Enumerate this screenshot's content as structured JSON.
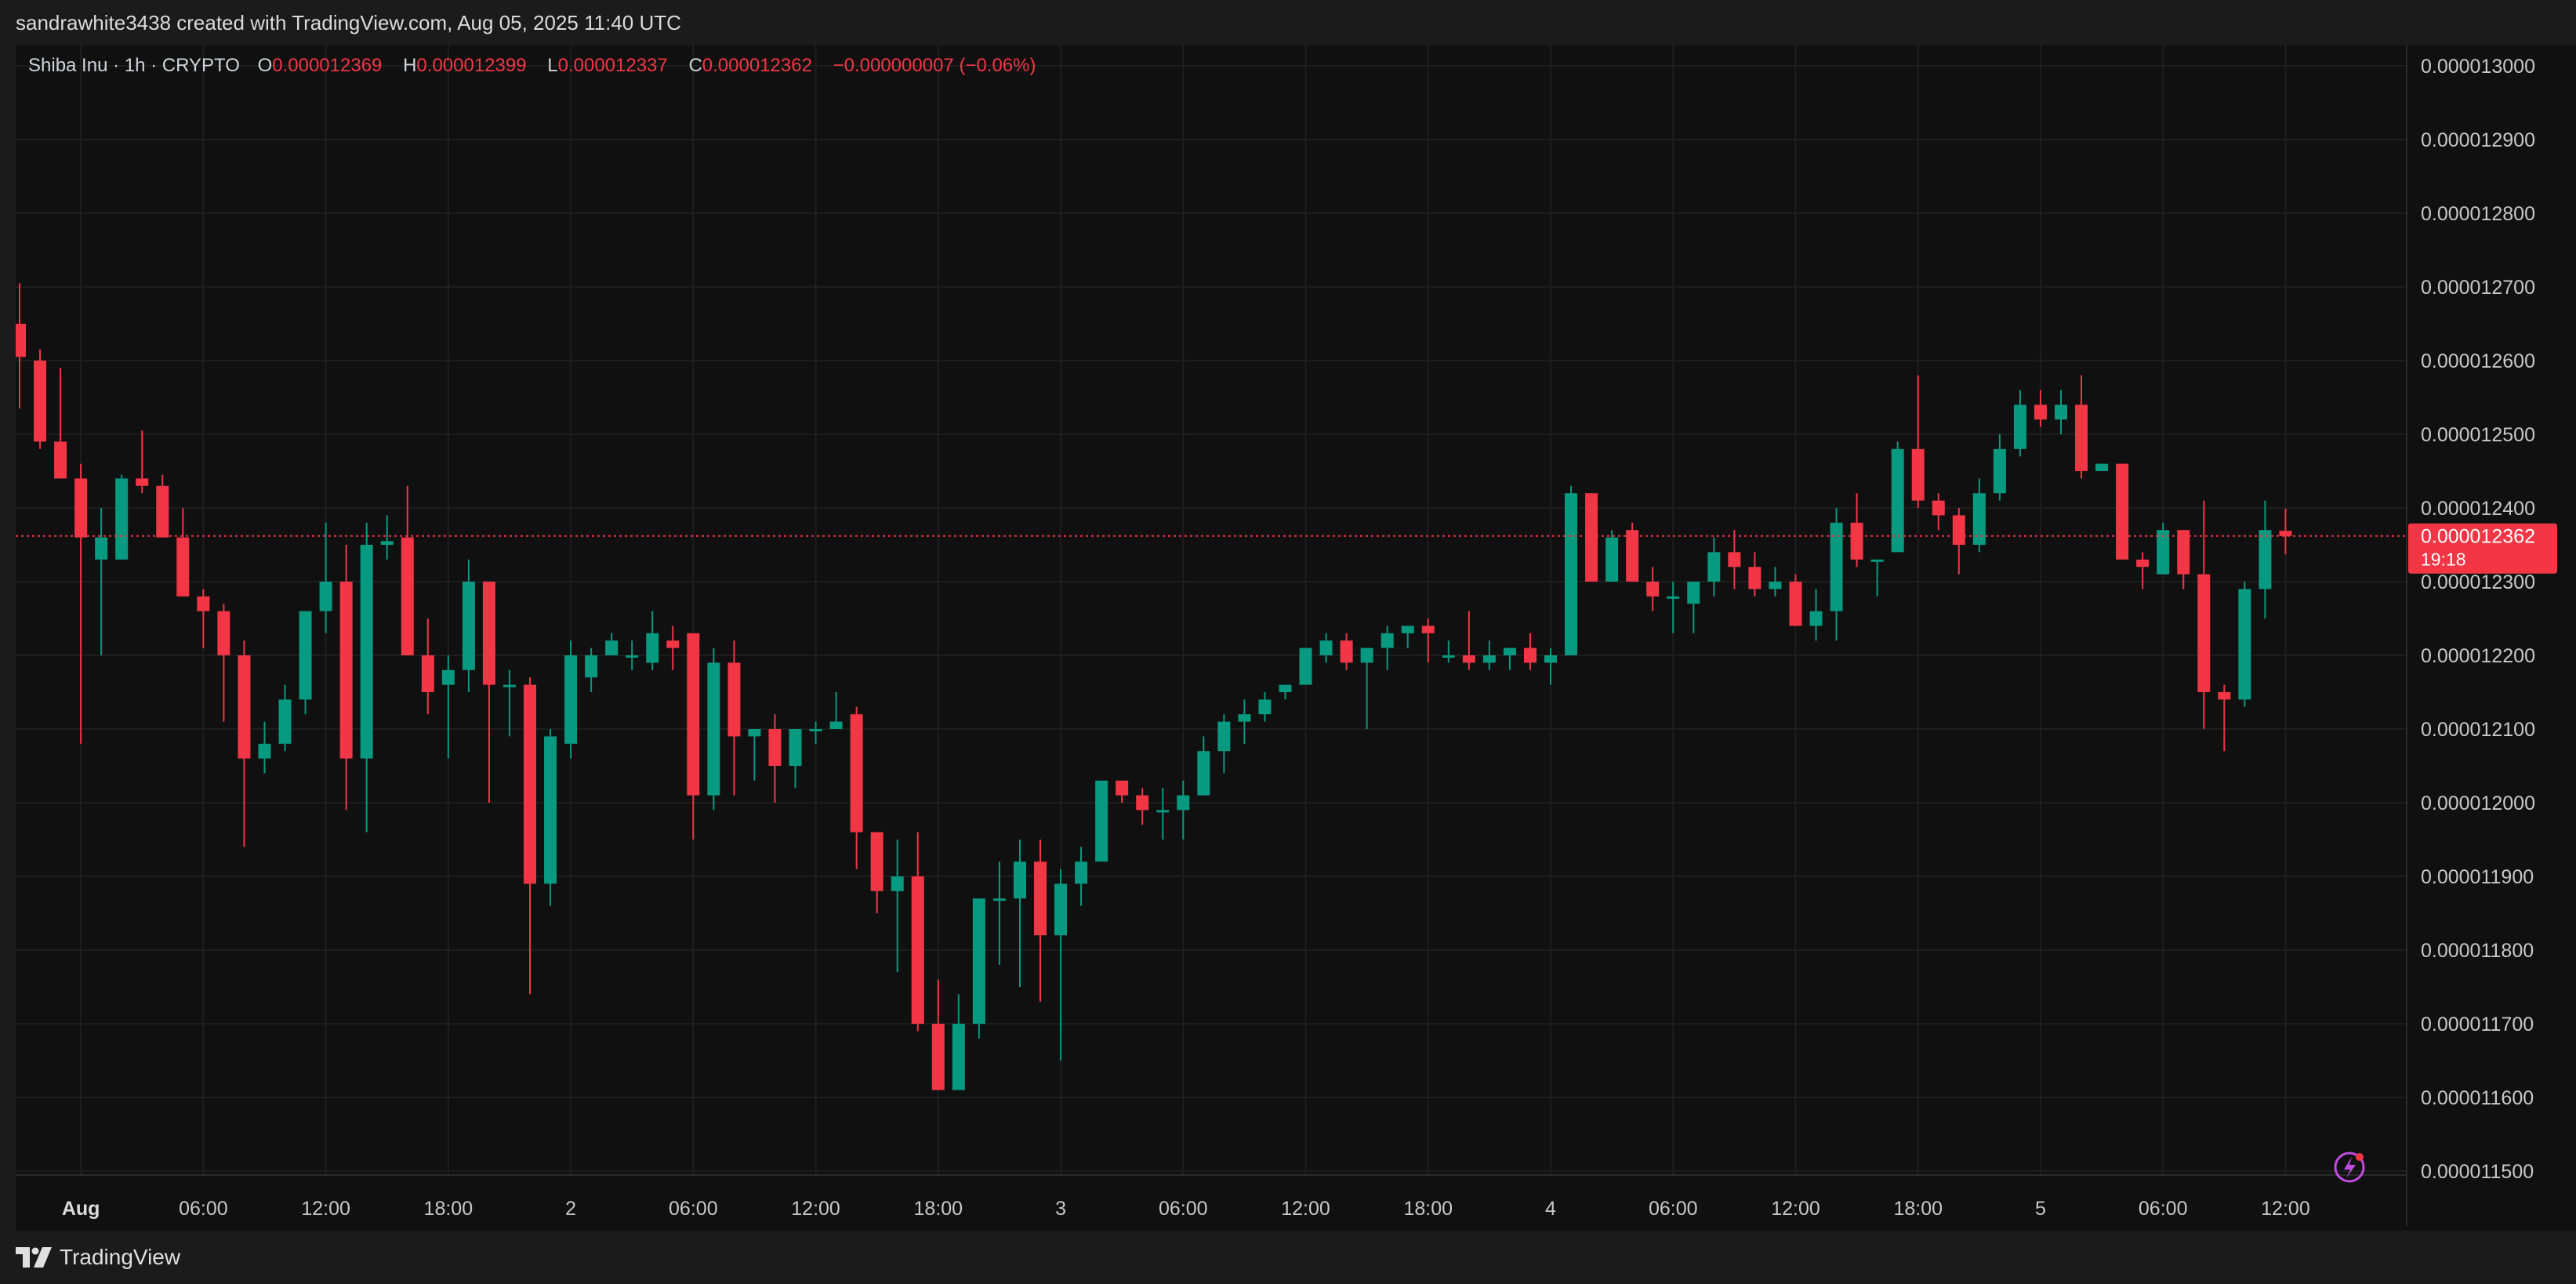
{
  "header": {
    "attribution": "sandrawhite3438 created with TradingView.com, Aug 05, 2025 11:40 UTC"
  },
  "legend": {
    "symbol": "Shiba Inu · 1h · CRYPTO",
    "open_label": "O",
    "open": "0.000012369",
    "high_label": "H",
    "high": "0.000012399",
    "low_label": "L",
    "low": "0.000012337",
    "close_label": "C",
    "close": "0.000012362",
    "change": "−0.000000007 (−0.06%)"
  },
  "price_tag": {
    "price": "0.000012362",
    "countdown": "19:18"
  },
  "footer": {
    "brand": "TradingView"
  },
  "colors": {
    "up": "#089981",
    "down": "#f23645",
    "background": "#101010",
    "frame": "#1b1b1b",
    "grid": "#1e1e1e"
  },
  "icons": {
    "brand": "tradingview-logo-icon",
    "lightning": "lightning-icon"
  },
  "chart_data": {
    "type": "candlestick",
    "interval": "1h",
    "y_axis": {
      "min": 1.15e-05,
      "max": 1.3e-05,
      "ticks": [
        "0.000013000",
        "0.000012900",
        "0.000012800",
        "0.000012700",
        "0.000012600",
        "0.000012500",
        "0.000012400",
        "0.000012300",
        "0.000012200",
        "0.000012100",
        "0.000012000",
        "0.000011900",
        "0.000011800",
        "0.000011700",
        "0.000011600",
        "0.000011500"
      ],
      "position": "right"
    },
    "x_axis": {
      "ticks": [
        {
          "label": "Aug",
          "index": 3,
          "bold": true
        },
        {
          "label": "06:00",
          "index": 9
        },
        {
          "label": "12:00",
          "index": 15
        },
        {
          "label": "18:00",
          "index": 21
        },
        {
          "label": "2",
          "index": 27
        },
        {
          "label": "06:00",
          "index": 33
        },
        {
          "label": "12:00",
          "index": 39
        },
        {
          "label": "18:00",
          "index": 45
        },
        {
          "label": "3",
          "index": 51
        },
        {
          "label": "06:00",
          "index": 57
        },
        {
          "label": "12:00",
          "index": 63
        },
        {
          "label": "18:00",
          "index": 69
        },
        {
          "label": "4",
          "index": 75
        },
        {
          "label": "06:00",
          "index": 81
        },
        {
          "label": "12:00",
          "index": 87
        },
        {
          "label": "18:00",
          "index": 93
        },
        {
          "label": "5",
          "index": 99
        },
        {
          "label": "06:00",
          "index": 105
        },
        {
          "label": "12:00",
          "index": 111
        }
      ]
    },
    "last_price": 1.2362e-05,
    "grid": true,
    "ohlc": [
      [
        12.65,
        12.705,
        12.535,
        12.605
      ],
      [
        12.6,
        12.615,
        12.48,
        12.49
      ],
      [
        12.49,
        12.59,
        12.44,
        12.44
      ],
      [
        12.44,
        12.46,
        12.08,
        12.36
      ],
      [
        12.33,
        12.4,
        12.2,
        12.36
      ],
      [
        12.33,
        12.445,
        12.33,
        12.44
      ],
      [
        12.44,
        12.505,
        12.42,
        12.43
      ],
      [
        12.43,
        12.445,
        12.36,
        12.36
      ],
      [
        12.36,
        12.4,
        12.28,
        12.28
      ],
      [
        12.28,
        12.29,
        12.21,
        12.26
      ],
      [
        12.26,
        12.27,
        12.11,
        12.2
      ],
      [
        12.2,
        12.22,
        11.94,
        12.06
      ],
      [
        12.06,
        12.11,
        12.04,
        12.08
      ],
      [
        12.08,
        12.16,
        12.07,
        12.14
      ],
      [
        12.14,
        12.26,
        12.12,
        12.26
      ],
      [
        12.26,
        12.38,
        12.23,
        12.3
      ],
      [
        12.3,
        12.35,
        11.99,
        12.06
      ],
      [
        12.06,
        12.38,
        11.96,
        12.35
      ],
      [
        12.35,
        12.39,
        12.33,
        12.355
      ],
      [
        12.36,
        12.43,
        12.2,
        12.2
      ],
      [
        12.2,
        12.25,
        12.12,
        12.15
      ],
      [
        12.16,
        12.2,
        12.06,
        12.18
      ],
      [
        12.18,
        12.33,
        12.15,
        12.3
      ],
      [
        12.3,
        12.3,
        12.0,
        12.16
      ],
      [
        12.16,
        12.18,
        12.09,
        12.16
      ],
      [
        12.16,
        12.17,
        11.74,
        11.89
      ],
      [
        11.89,
        12.1,
        11.86,
        12.09
      ],
      [
        12.08,
        12.22,
        12.06,
        12.2
      ],
      [
        12.17,
        12.21,
        12.15,
        12.2
      ],
      [
        12.2,
        12.23,
        12.2,
        12.22
      ],
      [
        12.2,
        12.22,
        12.18,
        12.2
      ],
      [
        12.19,
        12.26,
        12.18,
        12.23
      ],
      [
        12.22,
        12.24,
        12.18,
        12.21
      ],
      [
        12.23,
        12.23,
        11.95,
        12.01
      ],
      [
        12.01,
        12.21,
        11.99,
        12.19
      ],
      [
        12.19,
        12.22,
        12.01,
        12.09
      ],
      [
        12.09,
        12.1,
        12.03,
        12.1
      ],
      [
        12.1,
        12.12,
        12.0,
        12.05
      ],
      [
        12.05,
        12.1,
        12.02,
        12.1
      ],
      [
        12.1,
        12.11,
        12.08,
        12.1
      ],
      [
        12.1,
        12.15,
        12.1,
        12.11
      ],
      [
        12.12,
        12.13,
        11.91,
        11.96
      ],
      [
        11.96,
        11.96,
        11.85,
        11.88
      ],
      [
        11.88,
        11.95,
        11.77,
        11.9
      ],
      [
        11.9,
        11.96,
        11.69,
        11.7
      ],
      [
        11.7,
        11.76,
        11.61,
        11.61
      ],
      [
        11.61,
        11.74,
        11.63,
        11.7
      ],
      [
        11.7,
        11.87,
        11.68,
        11.87
      ],
      [
        11.87,
        11.92,
        11.78,
        11.87
      ],
      [
        11.87,
        11.95,
        11.75,
        11.92
      ],
      [
        11.92,
        11.95,
        11.73,
        11.82
      ],
      [
        11.82,
        11.91,
        11.65,
        11.89
      ],
      [
        11.89,
        11.94,
        11.86,
        11.92
      ],
      [
        11.92,
        12.03,
        11.93,
        12.03
      ],
      [
        12.03,
        12.03,
        12.0,
        12.01
      ],
      [
        12.01,
        12.02,
        11.97,
        11.99
      ],
      [
        11.99,
        12.02,
        11.95,
        11.99
      ],
      [
        11.99,
        12.03,
        11.95,
        12.01
      ],
      [
        12.01,
        12.09,
        12.01,
        12.07
      ],
      [
        12.07,
        12.12,
        12.04,
        12.11
      ],
      [
        12.11,
        12.14,
        12.08,
        12.12
      ],
      [
        12.12,
        12.15,
        12.11,
        12.14
      ],
      [
        12.15,
        12.16,
        12.14,
        12.16
      ],
      [
        12.16,
        12.21,
        12.16,
        12.21
      ],
      [
        12.2,
        12.23,
        12.19,
        12.22
      ],
      [
        12.22,
        12.23,
        12.18,
        12.19
      ],
      [
        12.19,
        12.21,
        12.1,
        12.21
      ],
      [
        12.21,
        12.24,
        12.18,
        12.23
      ],
      [
        12.23,
        12.24,
        12.21,
        12.24
      ],
      [
        12.24,
        12.25,
        12.19,
        12.23
      ],
      [
        12.2,
        12.22,
        12.19,
        12.2
      ],
      [
        12.2,
        12.26,
        12.18,
        12.19
      ],
      [
        12.19,
        12.22,
        12.18,
        12.2
      ],
      [
        12.2,
        12.21,
        12.18,
        12.21
      ],
      [
        12.21,
        12.23,
        12.18,
        12.19
      ],
      [
        12.19,
        12.21,
        12.16,
        12.2
      ],
      [
        12.2,
        12.43,
        12.2,
        12.42
      ],
      [
        12.42,
        12.42,
        12.3,
        12.3
      ],
      [
        12.3,
        12.37,
        12.3,
        12.36
      ],
      [
        12.37,
        12.38,
        12.3,
        12.3
      ],
      [
        12.3,
        12.32,
        12.26,
        12.28
      ],
      [
        12.28,
        12.3,
        12.23,
        12.28
      ],
      [
        12.27,
        12.3,
        12.23,
        12.3
      ],
      [
        12.3,
        12.36,
        12.28,
        12.34
      ],
      [
        12.34,
        12.37,
        12.29,
        12.32
      ],
      [
        12.32,
        12.34,
        12.28,
        12.29
      ],
      [
        12.29,
        12.32,
        12.28,
        12.3
      ],
      [
        12.3,
        12.31,
        12.24,
        12.24
      ],
      [
        12.24,
        12.29,
        12.22,
        12.26
      ],
      [
        12.26,
        12.4,
        12.22,
        12.38
      ],
      [
        12.38,
        12.42,
        12.32,
        12.33
      ],
      [
        12.33,
        12.33,
        12.28,
        12.33
      ],
      [
        12.34,
        12.49,
        12.34,
        12.48
      ],
      [
        12.48,
        12.58,
        12.4,
        12.41
      ],
      [
        12.41,
        12.42,
        12.37,
        12.39
      ],
      [
        12.39,
        12.4,
        12.31,
        12.35
      ],
      [
        12.35,
        12.44,
        12.34,
        12.42
      ],
      [
        12.42,
        12.5,
        12.41,
        12.48
      ],
      [
        12.48,
        12.56,
        12.47,
        12.54
      ],
      [
        12.54,
        12.56,
        12.51,
        12.52
      ],
      [
        12.52,
        12.56,
        12.5,
        12.54
      ],
      [
        12.54,
        12.58,
        12.44,
        12.45
      ],
      [
        12.45,
        12.46,
        12.45,
        12.46
      ],
      [
        12.46,
        12.46,
        12.33,
        12.33
      ],
      [
        12.33,
        12.34,
        12.29,
        12.32
      ],
      [
        12.31,
        12.38,
        12.31,
        12.37
      ],
      [
        12.37,
        12.37,
        12.29,
        12.31
      ],
      [
        12.31,
        12.41,
        12.1,
        12.15
      ],
      [
        12.15,
        12.16,
        12.07,
        12.14
      ],
      [
        12.14,
        12.3,
        12.13,
        12.29
      ],
      [
        12.29,
        12.41,
        12.25,
        12.37
      ],
      [
        12.369,
        12.399,
        12.337,
        12.362
      ]
    ]
  }
}
